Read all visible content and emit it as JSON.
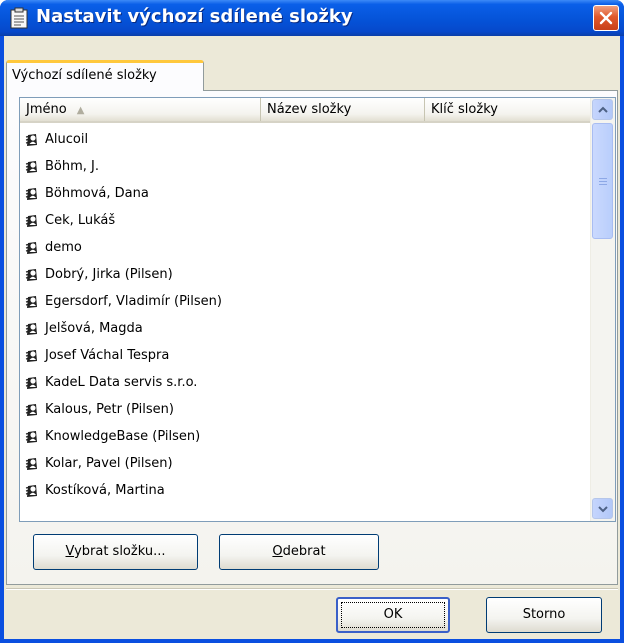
{
  "window": {
    "title": "Nastavit výchozí sdílené složky"
  },
  "tab": {
    "label": "Výchozí sdílené složky"
  },
  "listview": {
    "columns": [
      "Jméno",
      "Název složky",
      "Klíč složky"
    ],
    "rows": [
      "Alucoil",
      "Böhm, J.",
      "Böhmová, Dana",
      "Cek, Lukáš",
      "demo",
      "Dobrý, Jirka (Pilsen)",
      "Egersdorf, Vladimír (Pilsen)",
      "Jelšová, Magda",
      "Josef Váchal Tespra",
      "KadeL Data servis s.r.o.",
      "Kalous, Petr (Pilsen)",
      "KnowledgeBase (Pilsen)",
      "Kolar, Pavel (Pilsen)",
      "Kostíková, Martina"
    ]
  },
  "buttons": {
    "select_folder": "Vybrat složku...",
    "remove": "Odebrat",
    "ok": "OK",
    "cancel": "Storno"
  },
  "icons": {
    "title": "clipboard-icon",
    "close": "close-icon",
    "row": "contact-card-icon",
    "scroll_up": "chevron-up-icon",
    "scroll_down": "chevron-down-icon"
  },
  "colors": {
    "titlebar": "#0553d8",
    "close": "#e0582c",
    "tab_accent": "#ffc83c",
    "face": "#ece9d8"
  }
}
